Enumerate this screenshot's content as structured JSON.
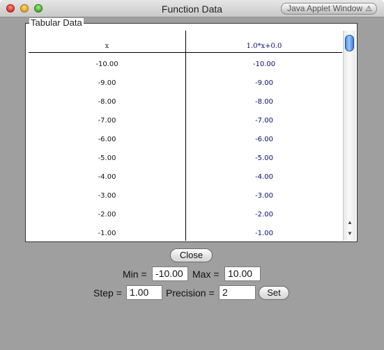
{
  "window": {
    "title": "Function Data",
    "badge": "Java Applet Window"
  },
  "group": {
    "legend": "Tabular Data"
  },
  "table": {
    "headers": {
      "x": "x",
      "f": "1.0*x+0.0"
    },
    "rows": [
      {
        "x": "-10.00",
        "f": "-10.00"
      },
      {
        "x": "-9.00",
        "f": "-9.00"
      },
      {
        "x": "-8.00",
        "f": "-8.00"
      },
      {
        "x": "-7.00",
        "f": "-7.00"
      },
      {
        "x": "-6.00",
        "f": "-6.00"
      },
      {
        "x": "-5.00",
        "f": "-5.00"
      },
      {
        "x": "-4.00",
        "f": "-4.00"
      },
      {
        "x": "-3.00",
        "f": "-3.00"
      },
      {
        "x": "-2.00",
        "f": "-2.00"
      },
      {
        "x": "-1.00",
        "f": "-1.00"
      }
    ]
  },
  "controls": {
    "close_label": "Close",
    "min_label": "Min =",
    "min_value": "-10.00",
    "max_label": "Max =",
    "max_value": "10.00",
    "step_label": "Step =",
    "step_value": "1.00",
    "precision_label": "Precision =",
    "precision_value": "2",
    "set_label": "Set"
  },
  "icons": {
    "badge_icon": "warning-icon",
    "scroll_up": "up-arrow-icon",
    "scroll_down": "down-arrow-icon"
  }
}
